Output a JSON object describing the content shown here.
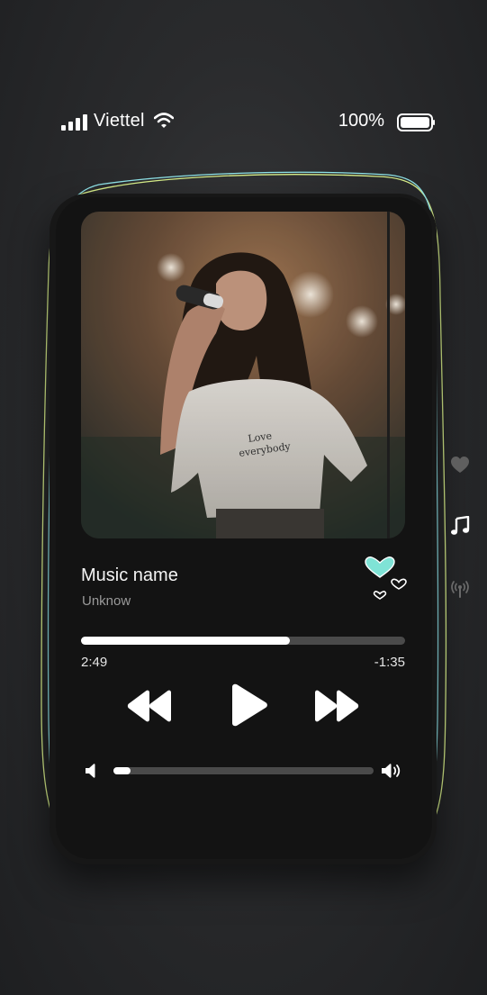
{
  "status_bar": {
    "carrier": "Viettel",
    "battery_percent": "100%",
    "battery_level": 1.0,
    "signal_bars": 4
  },
  "track": {
    "title": "Music name",
    "artist": "Unknow",
    "artwork": "singer-performing-photo"
  },
  "playback": {
    "elapsed": "2:49",
    "remaining": "-1:35",
    "progress_fraction": 0.645,
    "volume_fraction": 0.065
  },
  "icons": {
    "rewind": "rewind-icon",
    "play": "play-icon",
    "forward": "fast-forward-icon",
    "volume_low": "volume-low-icon",
    "volume_high": "volume-high-icon",
    "like": "heart-icon"
  },
  "side_nav": [
    {
      "name": "favorites",
      "icon": "heart-icon",
      "active": false
    },
    {
      "name": "music",
      "icon": "music-note-icon",
      "active": true
    },
    {
      "name": "broadcast",
      "icon": "broadcast-icon",
      "active": false
    }
  ],
  "colors": {
    "accent_heart": "#7fe3d6",
    "outline_cyan": "#8fe3e8",
    "outline_yellow": "#d8ef8a",
    "progress_track": "#4a4a4a",
    "progress_fill": "#ffffff"
  }
}
